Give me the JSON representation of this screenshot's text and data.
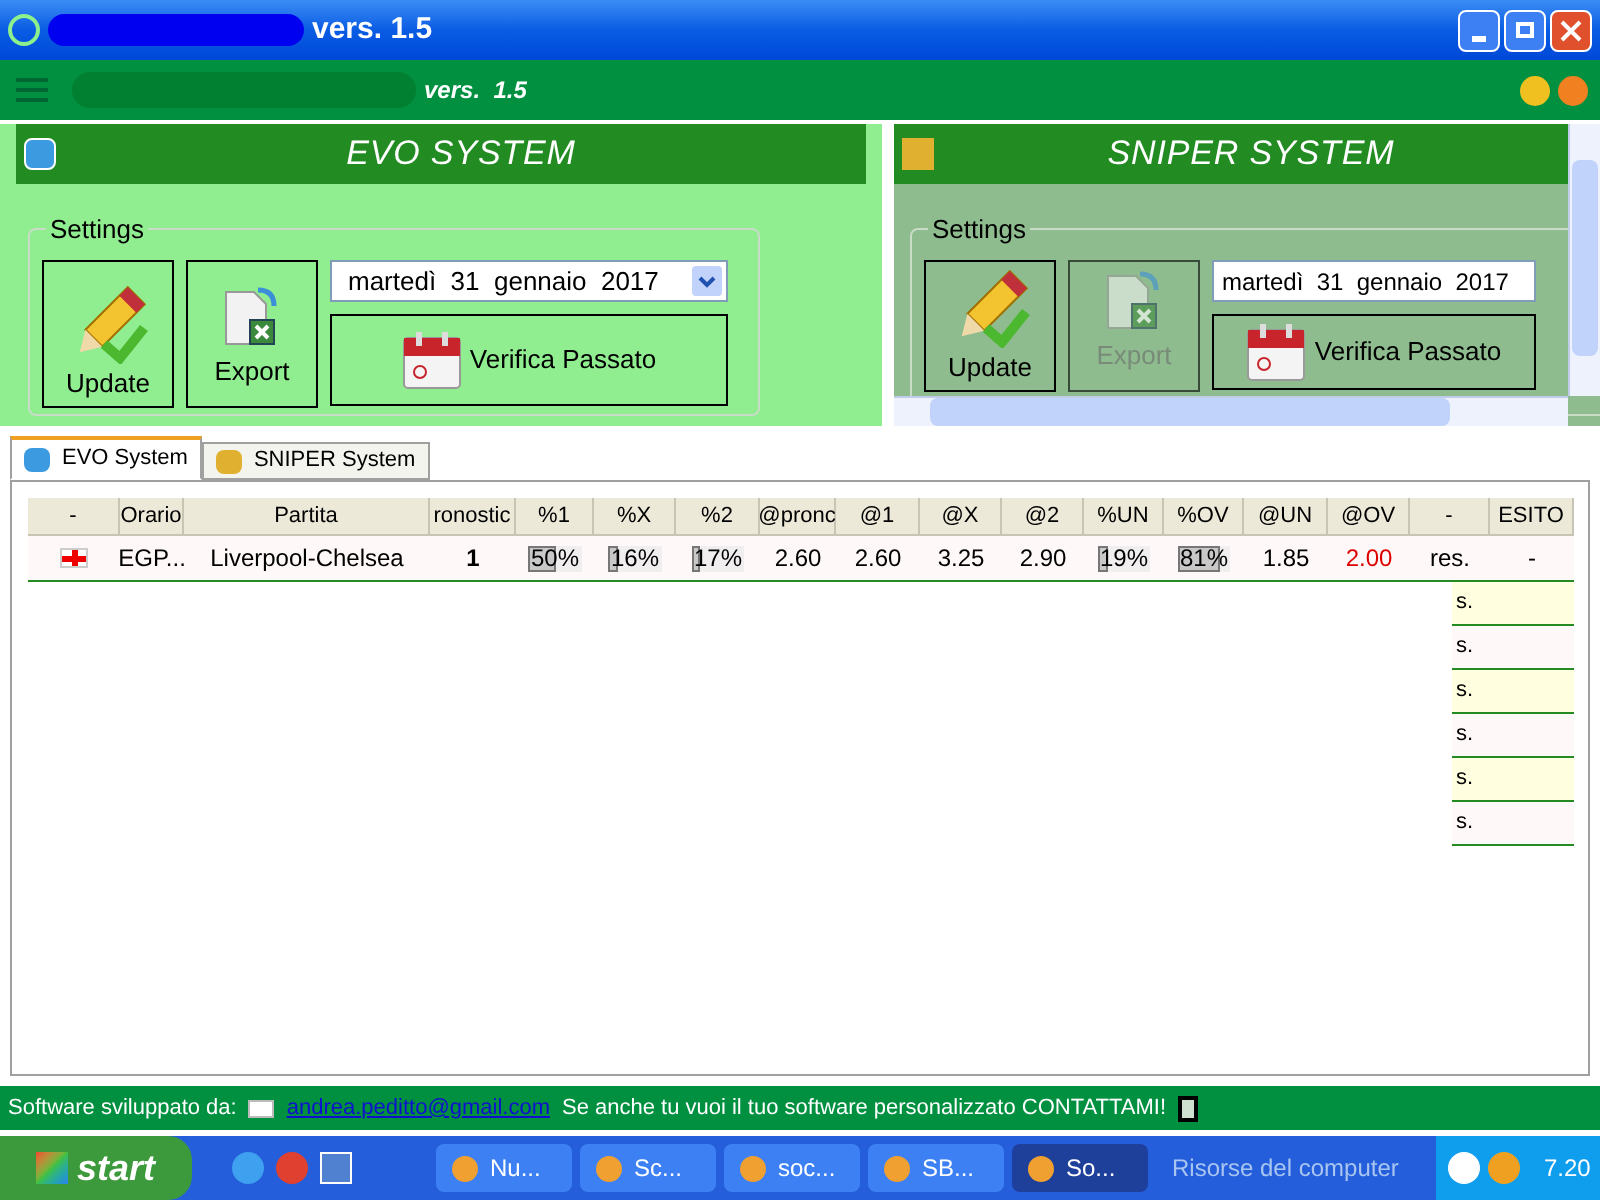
{
  "window": {
    "title": "vers. 1.5"
  },
  "header": {
    "version": "vers.  1.5"
  },
  "panels": [
    {
      "title": "EVO SYSTEM",
      "kind": "evo",
      "group": "Settings",
      "update": "Update",
      "export": {
        "label": "Export",
        "disabled": false
      },
      "date": "martedì  31  gennaio  2017",
      "verify": "Verifica Passato"
    },
    {
      "title": "SNIPER SYSTEM",
      "kind": "sniper",
      "group": "Settings",
      "update": "Update",
      "export": {
        "label": "Export",
        "disabled": true
      },
      "date": "martedì  31  gennaio  2017",
      "verify": "Verifica Passato"
    }
  ],
  "tabs": [
    {
      "label": "EVO System",
      "selected": true,
      "kind": "evo"
    },
    {
      "label": "SNIPER System",
      "selected": false,
      "kind": "sniper"
    }
  ],
  "table": {
    "columns": [
      "-",
      "Orario",
      "Partita",
      "ronostic",
      "%1",
      "%X",
      "%2",
      "@pronc",
      "@1",
      "@X",
      "@2",
      "%UN",
      "%OV",
      "@UN",
      "@OV",
      "-",
      "ESITO"
    ],
    "rows": [
      {
        "cells": [
          {
            "kind": "flag"
          },
          {
            "kind": "text",
            "text": "EGP..."
          },
          {
            "kind": "text",
            "text": "Liverpool-Chelsea"
          },
          {
            "kind": "bold",
            "text": "1"
          },
          {
            "kind": "bar",
            "text": "50%",
            "level": 0.5
          },
          {
            "kind": "bar",
            "text": "16%",
            "level": 0.16
          },
          {
            "kind": "bar",
            "text": "17%",
            "level": 0.17
          },
          {
            "kind": "text",
            "text": "2.60"
          },
          {
            "kind": "text",
            "text": "2.60"
          },
          {
            "kind": "text",
            "text": "3.25"
          },
          {
            "kind": "text",
            "text": "2.90"
          },
          {
            "kind": "bar",
            "text": "19%",
            "level": 0.19
          },
          {
            "kind": "bar",
            "text": "81%",
            "level": 0.81
          },
          {
            "kind": "text",
            "text": "1.85"
          },
          {
            "kind": "text",
            "text": "2.00",
            "color": "#dd0000"
          },
          {
            "kind": "text",
            "text": "res."
          },
          {
            "kind": "text",
            "text": "-"
          }
        ]
      }
    ],
    "extra_rows": [
      "s.",
      "s.",
      "s.",
      "s.",
      "s.",
      "s."
    ]
  },
  "footer": {
    "label": "Software sviluppato da:",
    "email": "andrea.peditto@gmail.com",
    "message": "Se anche tu vuoi il tuo software personalizzato CONTATTAMI!"
  },
  "taskbar": {
    "start": "start",
    "tasks": [
      {
        "label": "Nu...",
        "selected": false
      },
      {
        "label": "Sc...",
        "selected": false
      },
      {
        "label": "soc...",
        "selected": false
      },
      {
        "label": "SB...",
        "selected": false
      },
      {
        "label": "So...",
        "selected": true
      }
    ],
    "address": "Risorse del computer",
    "clock": "7.20"
  }
}
